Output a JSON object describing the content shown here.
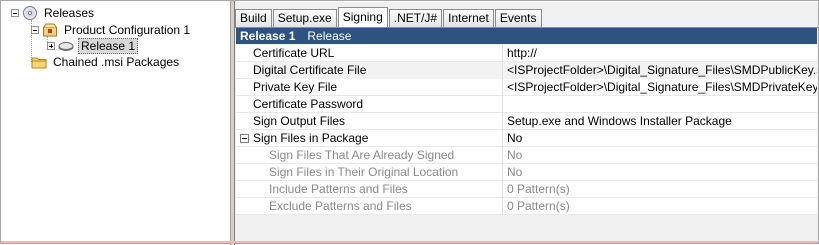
{
  "tree": {
    "root": {
      "label": "Releases"
    },
    "product": {
      "label": "Product Configuration 1"
    },
    "release": {
      "label": "Release 1"
    },
    "chained": {
      "label": "Chained .msi Packages"
    }
  },
  "tabs": [
    {
      "label": "Build"
    },
    {
      "label": "Setup.exe"
    },
    {
      "label": "Signing",
      "active": true
    },
    {
      "label": ".NET/J#"
    },
    {
      "label": "Internet"
    },
    {
      "label": "Events"
    }
  ],
  "header": {
    "title": "Release 1",
    "subtitle": "Release"
  },
  "properties": [
    {
      "name": "Certificate URL",
      "value": "http://"
    },
    {
      "name": "Digital Certificate File",
      "value": "<ISProjectFolder>\\Digital_Signature_Files\\SMDPublicKey.spc"
    },
    {
      "name": "Private Key File",
      "value": "<ISProjectFolder>\\Digital_Signature_Files\\SMDPrivateKey.pvk"
    },
    {
      "name": "Certificate Password",
      "value": ""
    },
    {
      "name": "Sign Output Files",
      "value": "Setup.exe and Windows Installer Package"
    },
    {
      "name": "Sign Files in Package",
      "value": "No"
    },
    {
      "name": "Sign Files That Are Already Signed",
      "value": "No"
    },
    {
      "name": "Sign Files in Their Original Location",
      "value": "No"
    },
    {
      "name": "Include Patterns and Files",
      "value": "0 Pattern(s)"
    },
    {
      "name": "Exclude Patterns and Files",
      "value": "0 Pattern(s)"
    }
  ],
  "colors": {
    "header_bg": "#2d5380",
    "selected_tree_bg": "#d9d9d9",
    "disabled_text": "#8a8a8a"
  },
  "icons": {
    "root": "cd-disc-icon",
    "product": "box-package-icon",
    "release": "release-drive-icon",
    "chained": "folder-icon"
  }
}
